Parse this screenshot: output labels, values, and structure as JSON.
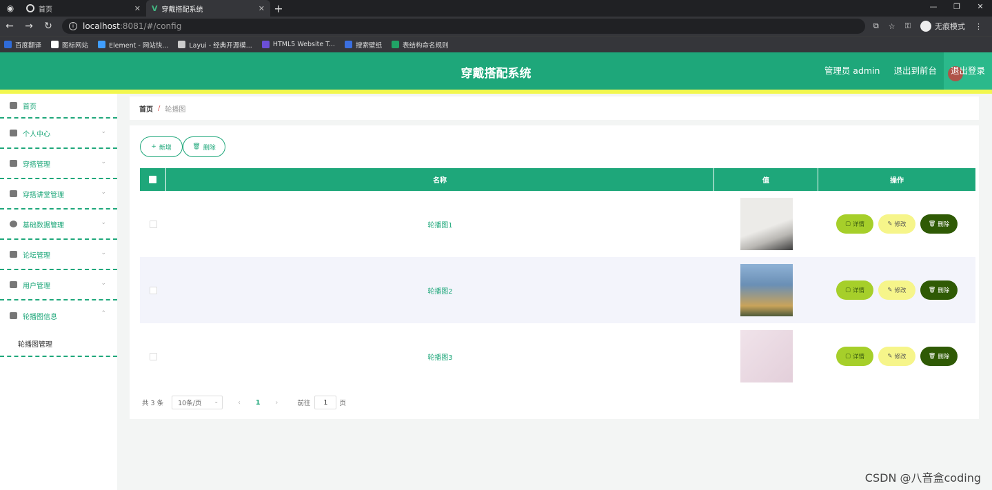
{
  "browser": {
    "tabs": [
      {
        "label": "首页"
      },
      {
        "label": "穿戴搭配系统"
      }
    ],
    "url_host": "localhost",
    "url_path": ":8081/#/config",
    "incognito_label": "无痕模式",
    "bookmarks": [
      {
        "label": "百度翻译",
        "color": "#2f6bd8"
      },
      {
        "label": "图标网站",
        "color": "#ffffff"
      },
      {
        "label": "Element - 网站快...",
        "color": "#409eff"
      },
      {
        "label": "Layui - 经典开源模...",
        "color": "#cccccc"
      },
      {
        "label": "HTML5 Website T...",
        "color": "#6b4fd8"
      },
      {
        "label": "搜索壁纸",
        "color": "#3b6fe0"
      },
      {
        "label": "表结构命名规则",
        "color": "#21a366"
      }
    ]
  },
  "header": {
    "title": "穿戴搭配系统",
    "user": "管理员 admin",
    "to_front": "退出到前台",
    "logout": "退出登录"
  },
  "sidebar": {
    "items": [
      {
        "label": "首页"
      },
      {
        "label": "个人中心"
      },
      {
        "label": "穿搭管理"
      },
      {
        "label": "穿搭讲堂管理"
      },
      {
        "label": "基础数据管理"
      },
      {
        "label": "论坛管理"
      },
      {
        "label": "用户管理"
      },
      {
        "label": "轮播图信息"
      }
    ],
    "sub_item": "轮播图管理"
  },
  "breadcrumb": {
    "home": "首页",
    "current": "轮播图"
  },
  "toolbar": {
    "add_label": "新增",
    "delete_label": "删除"
  },
  "table": {
    "headers": [
      "名称",
      "值",
      "操作"
    ],
    "rows": [
      {
        "name": "轮播图1",
        "img_colors": [
          "#e9e7e4",
          "#3c3c3c"
        ]
      },
      {
        "name": "轮播图2",
        "img_colors": [
          "#6a8fb5",
          "#c9a35a"
        ]
      },
      {
        "name": "轮播图3",
        "img_colors": [
          "#ecdde6",
          "#e3cfda"
        ]
      }
    ],
    "op_detail": "详情",
    "op_edit": "修改",
    "op_delete": "删除"
  },
  "pager": {
    "total": "共 3 条",
    "page_size": "10条/页",
    "current_page": "1",
    "goto_label": "前往",
    "goto_value": "1",
    "page_suffix": "页"
  },
  "watermark": "CSDN @八音盒coding"
}
